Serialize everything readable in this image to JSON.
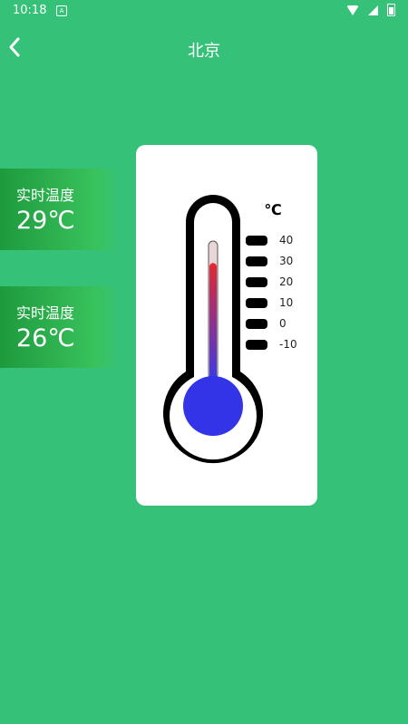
{
  "status": {
    "time": "10:18",
    "notif_letter": "A"
  },
  "header": {
    "title": "北京"
  },
  "cards": [
    {
      "label": "实时温度",
      "value": "29℃"
    },
    {
      "label": "实时温度",
      "value": "26℃"
    }
  ],
  "thermometer": {
    "unit": "℃",
    "scale": [
      "40",
      "30",
      "20",
      "10",
      "0",
      "-10"
    ],
    "scale_min": -10,
    "scale_max": 40,
    "current": 29,
    "colors": {
      "outline": "#000000",
      "bulb": "#3333E8",
      "mercury_top": "#E8282E",
      "mercury_bottom": "#3A3AE8",
      "tube": "#E8D6D6"
    }
  },
  "icons": {
    "back": "chevron-left-icon",
    "wifi": "wifi-icon",
    "signal": "signal-icon",
    "battery": "battery-icon"
  }
}
